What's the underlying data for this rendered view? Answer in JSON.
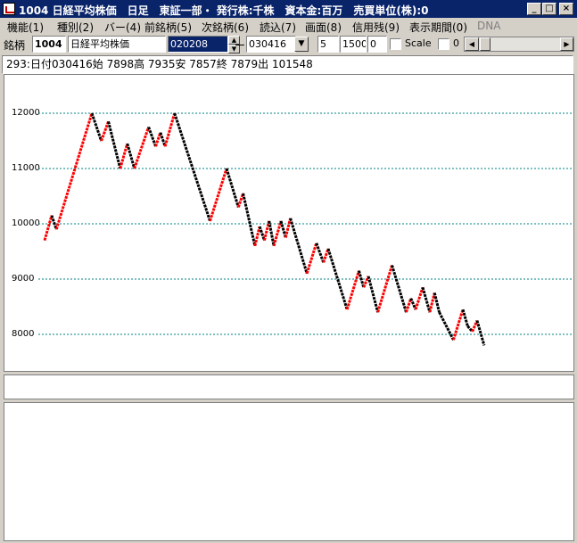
{
  "window": {
    "title": "1004 日経平均株価　日足　東証一部・ 発行株:千株　資本金:百万　売買単位(株):0",
    "buttons": [
      "_",
      "□",
      "×"
    ]
  },
  "menu": [
    "機能(1)",
    "種別(2)",
    "バー(4)",
    "前銘柄(5)",
    "次銘柄(6)",
    "読込(7)",
    "画面(8)",
    "信用残(9)",
    "表示期間(0)",
    "DNA"
  ],
  "toolbar": {
    "label": "銘柄",
    "code": "1004",
    "name": "日経平均株価",
    "start_date": "020208",
    "dash": "ー",
    "end_date": "030416",
    "field1": "5",
    "field2": "1500",
    "field3": "0",
    "scale_label": "Scale",
    "scale_value": "0"
  },
  "info_line": "293:日付030416始 7898高 7935安 7857終 7879出 101548",
  "chart_data": {
    "type": "line",
    "y_ticks": [
      "12000",
      "11000",
      "10000",
      "9000",
      "8000"
    ],
    "ylim": [
      7600,
      13200
    ],
    "grid": true,
    "up_color": "#ff0000",
    "down_color": "#000000",
    "points": [
      [
        0,
        9700
      ],
      [
        3,
        10150
      ],
      [
        5,
        9900
      ],
      [
        20,
        12000
      ],
      [
        24,
        11500
      ],
      [
        27,
        11850
      ],
      [
        32,
        11000
      ],
      [
        35,
        11450
      ],
      [
        38,
        11000
      ],
      [
        44,
        11750
      ],
      [
        47,
        11400
      ],
      [
        49,
        11650
      ],
      [
        51,
        11400
      ],
      [
        55,
        12000
      ],
      [
        70,
        10050
      ],
      [
        77,
        11000
      ],
      [
        82,
        10300
      ],
      [
        84,
        10550
      ],
      [
        89,
        9600
      ],
      [
        91,
        9950
      ],
      [
        93,
        9700
      ],
      [
        95,
        10050
      ],
      [
        97,
        9600
      ],
      [
        100,
        10050
      ],
      [
        102,
        9750
      ],
      [
        104,
        10100
      ],
      [
        111,
        9100
      ],
      [
        115,
        9650
      ],
      [
        118,
        9300
      ],
      [
        120,
        9550
      ],
      [
        128,
        8450
      ],
      [
        133,
        9150
      ],
      [
        135,
        8850
      ],
      [
        137,
        9050
      ],
      [
        141,
        8400
      ],
      [
        147,
        9250
      ],
      [
        153,
        8400
      ],
      [
        155,
        8650
      ],
      [
        157,
        8450
      ],
      [
        160,
        8850
      ],
      [
        163,
        8400
      ],
      [
        165,
        8750
      ],
      [
        167,
        8400
      ],
      [
        173,
        7900
      ],
      [
        177,
        8450
      ],
      [
        179,
        8150
      ],
      [
        181,
        8050
      ],
      [
        183,
        8250
      ],
      [
        186,
        7800
      ]
    ]
  }
}
